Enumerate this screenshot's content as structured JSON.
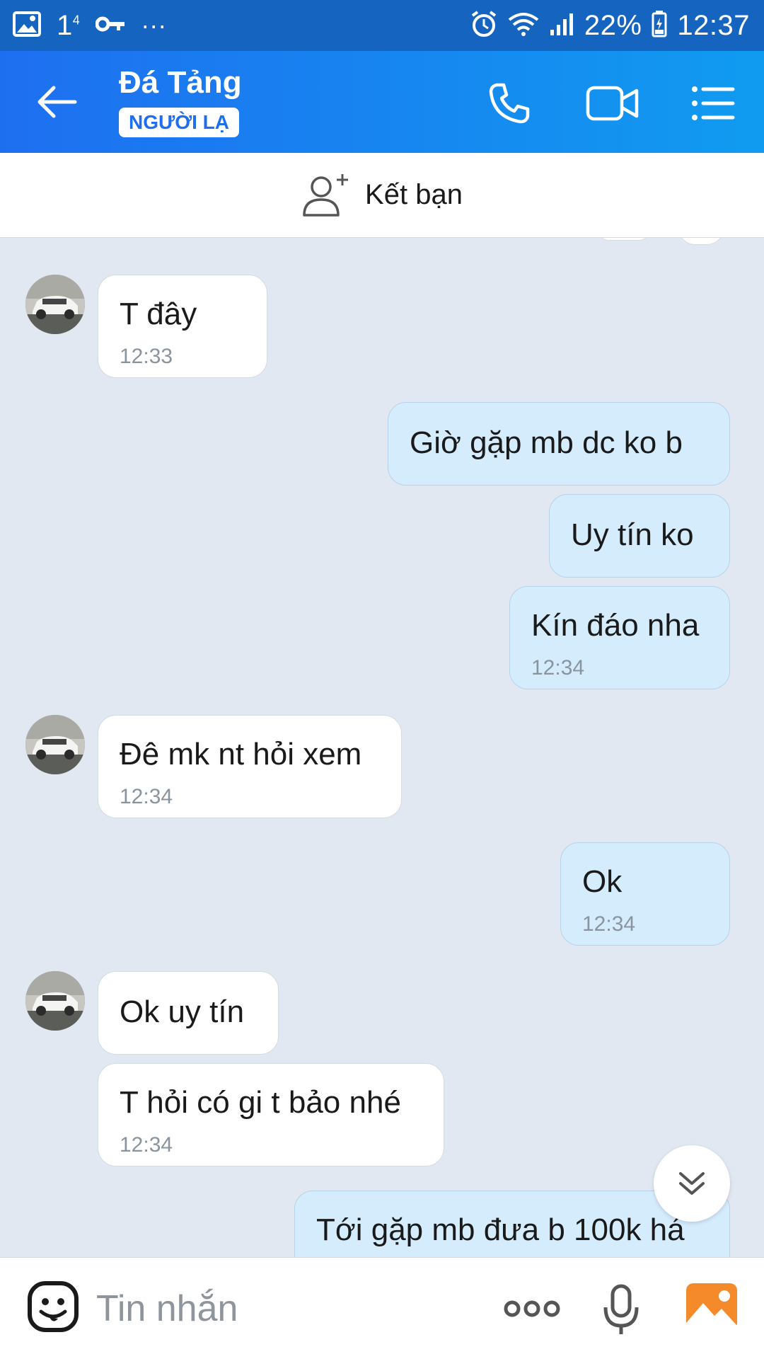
{
  "status_bar": {
    "notif_count": "1",
    "notif_sup": "4",
    "dots": "···",
    "battery": "22%",
    "time": "12:37"
  },
  "header": {
    "name": "Đá Tảng",
    "badge": "NGƯỜI LẠ",
    "accent_color": "#1e6ff0"
  },
  "add_friend": {
    "label": "Kết bạn"
  },
  "messages": [
    {
      "dir": "in",
      "text": "T đây",
      "time": "12:33"
    },
    {
      "dir": "out",
      "text": "Giờ gặp mb dc ko b",
      "time": ""
    },
    {
      "dir": "out",
      "text": "Uy tín ko",
      "time": ""
    },
    {
      "dir": "out",
      "text": "Kín đáo nha",
      "time": "12:34"
    },
    {
      "dir": "in",
      "text": "Đê mk nt hỏi xem",
      "time": "12:34"
    },
    {
      "dir": "out",
      "text": "Ok",
      "time": "12:34"
    },
    {
      "dir": "in",
      "text": "Ok uy tín",
      "time": ""
    },
    {
      "dir": "in",
      "text": "T hỏi có gi t bảo nhé",
      "time": "12:34"
    },
    {
      "dir": "out",
      "text": "Tới gặp mb đưa b 100k há",
      "time": ""
    }
  ],
  "input": {
    "placeholder": "Tin nhắn",
    "more_icon": "more-dots-icon"
  }
}
